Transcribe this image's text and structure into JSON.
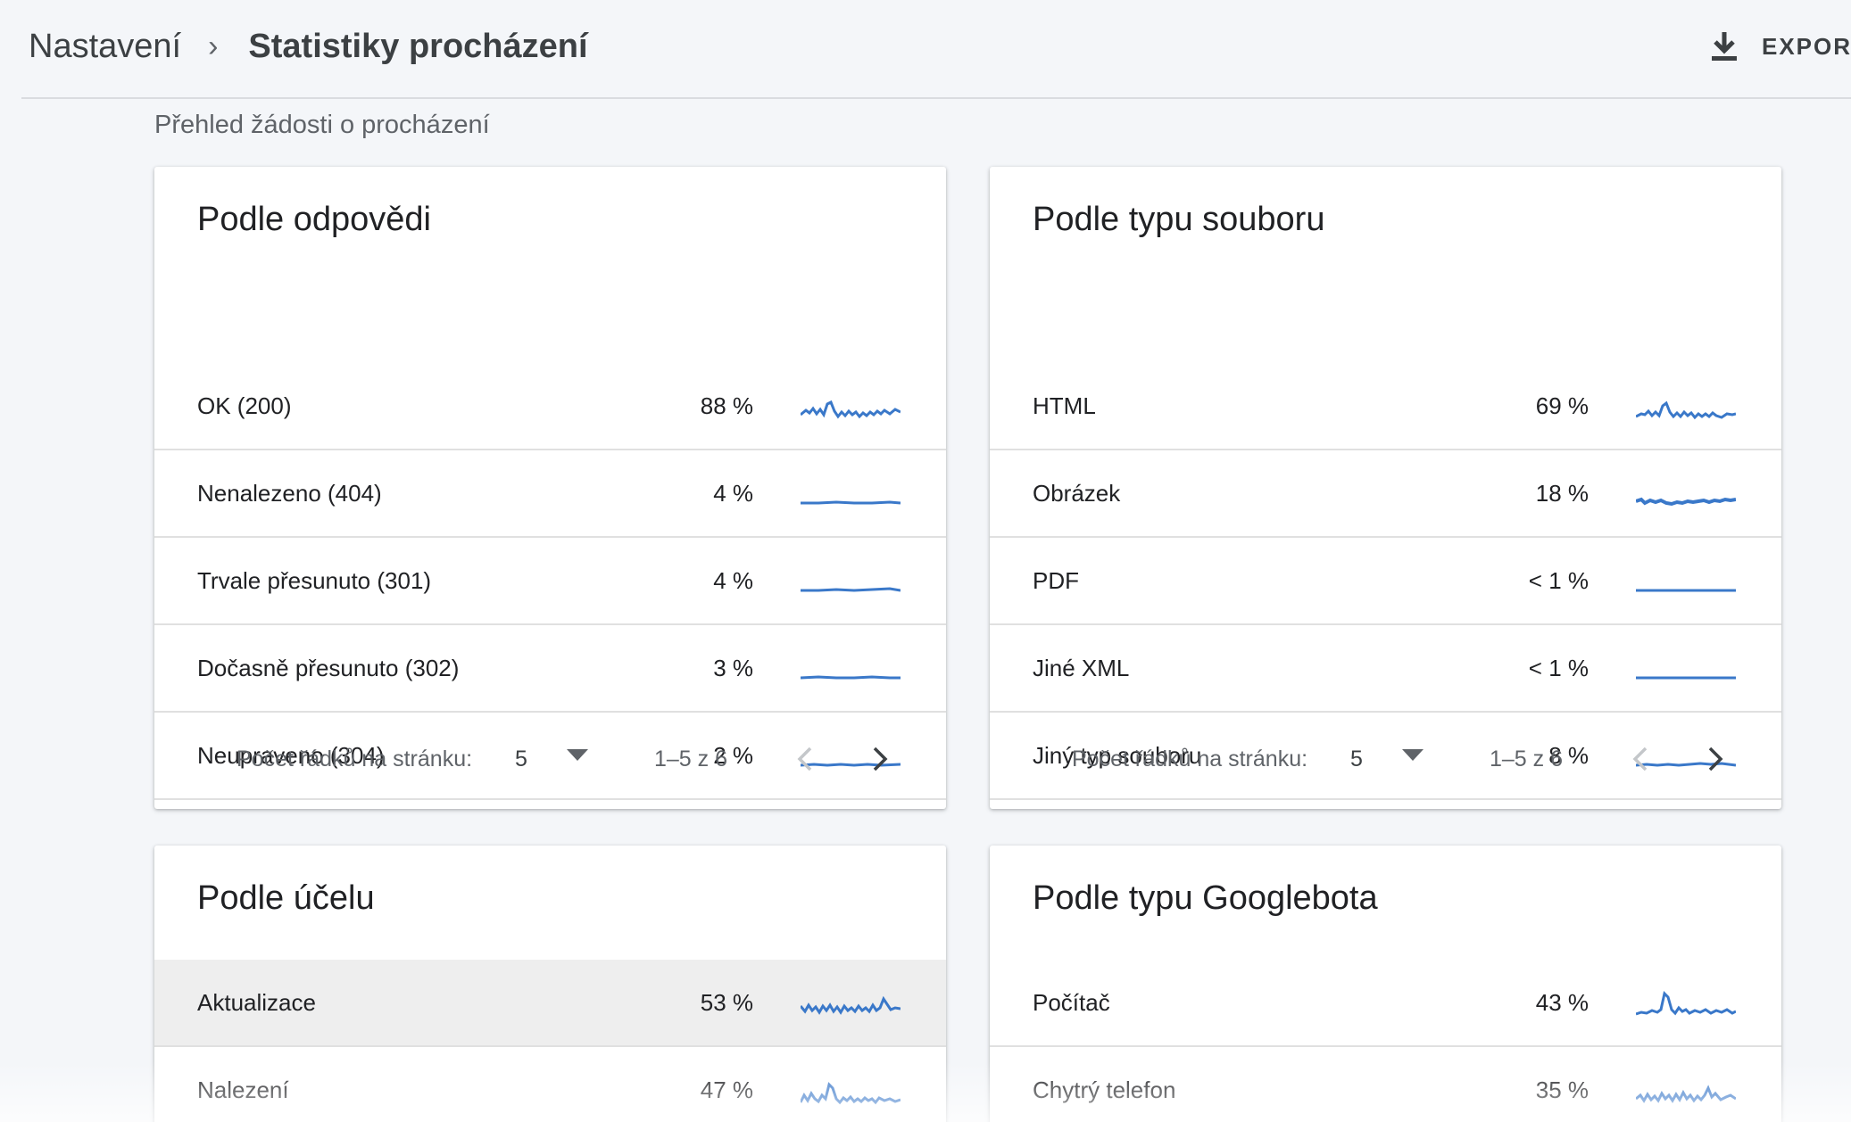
{
  "header": {
    "breadcrumb_parent": "Nastavení",
    "breadcrumb_separator": "›",
    "breadcrumb_current": "Statistiky procházení",
    "export_label": "EXPORT"
  },
  "overview": {
    "label": "Přehled žádosti o procházení"
  },
  "colors": {
    "accent": "#3a78c9",
    "text": "#202124",
    "muted": "#5f6368",
    "divider": "#e0e0e0",
    "highlight_row": "#eeeeee"
  },
  "cards": [
    {
      "title": "Podle odpovědi",
      "rows": [
        {
          "label": "OK (200)",
          "pct": "88 %"
        },
        {
          "label": "Nenalezeno (404)",
          "pct": "4 %"
        },
        {
          "label": "Trvale přesunuto (301)",
          "pct": "4 %"
        },
        {
          "label": "Dočasně přesunuto (302)",
          "pct": "3 %"
        },
        {
          "label": "Neupraveno (304)",
          "pct": "2 %"
        }
      ],
      "pager": {
        "rows_per_page_label": "Počet řádků na stránku:",
        "rows_per_page": "5",
        "range": "1–5 z 6"
      }
    },
    {
      "title": "Podle typu souboru",
      "rows": [
        {
          "label": "HTML",
          "pct": "69 %"
        },
        {
          "label": "Obrázek",
          "pct": "18 %"
        },
        {
          "label": "PDF",
          "pct": "< 1 %"
        },
        {
          "label": "Jiné XML",
          "pct": "< 1 %"
        },
        {
          "label": "Jiný typ souboru",
          "pct": "8 %"
        }
      ],
      "pager": {
        "rows_per_page_label": "Počet řádků na stránku:",
        "rows_per_page": "5",
        "range": "1–5 z 6"
      }
    },
    {
      "title": "Podle účelu",
      "rows": [
        {
          "label": "Aktualizace",
          "pct": "53 %"
        },
        {
          "label": "Nalezení",
          "pct": "47 %"
        }
      ]
    },
    {
      "title": "Podle typu Googlebota",
      "rows": [
        {
          "label": "Počítač",
          "pct": "43 %"
        },
        {
          "label": "Chytrý telefon",
          "pct": "35 %"
        }
      ]
    }
  ]
}
